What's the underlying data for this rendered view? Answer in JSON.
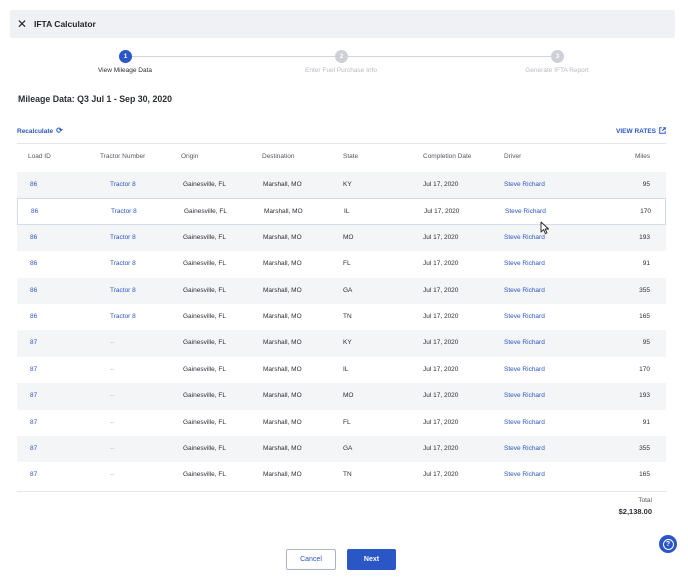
{
  "window": {
    "title": "IFTA Calculator",
    "close_icon": "close-icon"
  },
  "stepper": {
    "steps": [
      {
        "number": "1",
        "label": "View Mileage Data",
        "state": "active"
      },
      {
        "number": "2",
        "label": "Enter Fuel Purchase Info",
        "state": "inactive"
      },
      {
        "number": "3",
        "label": "Generate IFTA Report",
        "state": "inactive"
      }
    ]
  },
  "heading": "Mileage Data: Q3 Jul 1 - Sep 30, 2020",
  "actions": {
    "recalculate_label": "Recalculate",
    "recalculate_icon": "refresh-icon",
    "view_rates_label": "VIEW RATES",
    "view_rates_icon": "external-link-icon"
  },
  "table": {
    "columns": [
      "Load ID",
      "Tractor Number",
      "Origin",
      "Destination",
      "State",
      "Completion Date",
      "Driver",
      "Miles"
    ],
    "rows": [
      {
        "load_id": "86",
        "tractor": "Tractor 8",
        "origin": "Gainesville, FL",
        "destination": "Marshall, MO",
        "state": "KY",
        "date": "Jul 17, 2020",
        "driver": "Steve Richard",
        "miles": "95"
      },
      {
        "load_id": "86",
        "tractor": "Tractor 8",
        "origin": "Gainesville, FL",
        "destination": "Marshall, MO",
        "state": "IL",
        "date": "Jul 17, 2020",
        "driver": "Steve Richard",
        "miles": "170"
      },
      {
        "load_id": "86",
        "tractor": "Tractor 8",
        "origin": "Gainesville, FL",
        "destination": "Marshall, MO",
        "state": "MO",
        "date": "Jul 17, 2020",
        "driver": "Steve Richard",
        "miles": "193"
      },
      {
        "load_id": "86",
        "tractor": "Tractor 8",
        "origin": "Gainesville, FL",
        "destination": "Marshall, MO",
        "state": "FL",
        "date": "Jul 17, 2020",
        "driver": "Steve Richard",
        "miles": "91"
      },
      {
        "load_id": "86",
        "tractor": "Tractor 8",
        "origin": "Gainesville, FL",
        "destination": "Marshall, MO",
        "state": "GA",
        "date": "Jul 17, 2020",
        "driver": "Steve Richard",
        "miles": "355"
      },
      {
        "load_id": "86",
        "tractor": "Tractor 8",
        "origin": "Gainesville, FL",
        "destination": "Marshall, MO",
        "state": "TN",
        "date": "Jul 17, 2020",
        "driver": "Steve Richard",
        "miles": "165"
      },
      {
        "load_id": "87",
        "tractor": "--",
        "origin": "Gainesville, FL",
        "destination": "Marshall, MO",
        "state": "KY",
        "date": "Jul 17, 2020",
        "driver": "Steve Richard",
        "miles": "95"
      },
      {
        "load_id": "87",
        "tractor": "--",
        "origin": "Gainesville, FL",
        "destination": "Marshall, MO",
        "state": "IL",
        "date": "Jul 17, 2020",
        "driver": "Steve Richard",
        "miles": "170"
      },
      {
        "load_id": "87",
        "tractor": "--",
        "origin": "Gainesville, FL",
        "destination": "Marshall, MO",
        "state": "MO",
        "date": "Jul 17, 2020",
        "driver": "Steve Richard",
        "miles": "193"
      },
      {
        "load_id": "87",
        "tractor": "--",
        "origin": "Gainesville, FL",
        "destination": "Marshall, MO",
        "state": "FL",
        "date": "Jul 17, 2020",
        "driver": "Steve Richard",
        "miles": "91"
      },
      {
        "load_id": "87",
        "tractor": "--",
        "origin": "Gainesville, FL",
        "destination": "Marshall, MO",
        "state": "GA",
        "date": "Jul 17, 2020",
        "driver": "Steve Richard",
        "miles": "355"
      },
      {
        "load_id": "87",
        "tractor": "--",
        "origin": "Gainesville, FL",
        "destination": "Marshall, MO",
        "state": "TN",
        "date": "Jul 17, 2020",
        "driver": "Steve Richard",
        "miles": "165"
      }
    ],
    "hovered_row": 1
  },
  "total": {
    "label": "Total",
    "value": "$2,138.00"
  },
  "footer": {
    "cancel_label": "Cancel",
    "next_label": "Next"
  },
  "help": {
    "icon": "help-icon",
    "glyph": "?"
  },
  "colors": {
    "accent": "#2a56c6",
    "row_stripe": "#f4f5f7",
    "inactive_step": "#cdd0d6"
  }
}
